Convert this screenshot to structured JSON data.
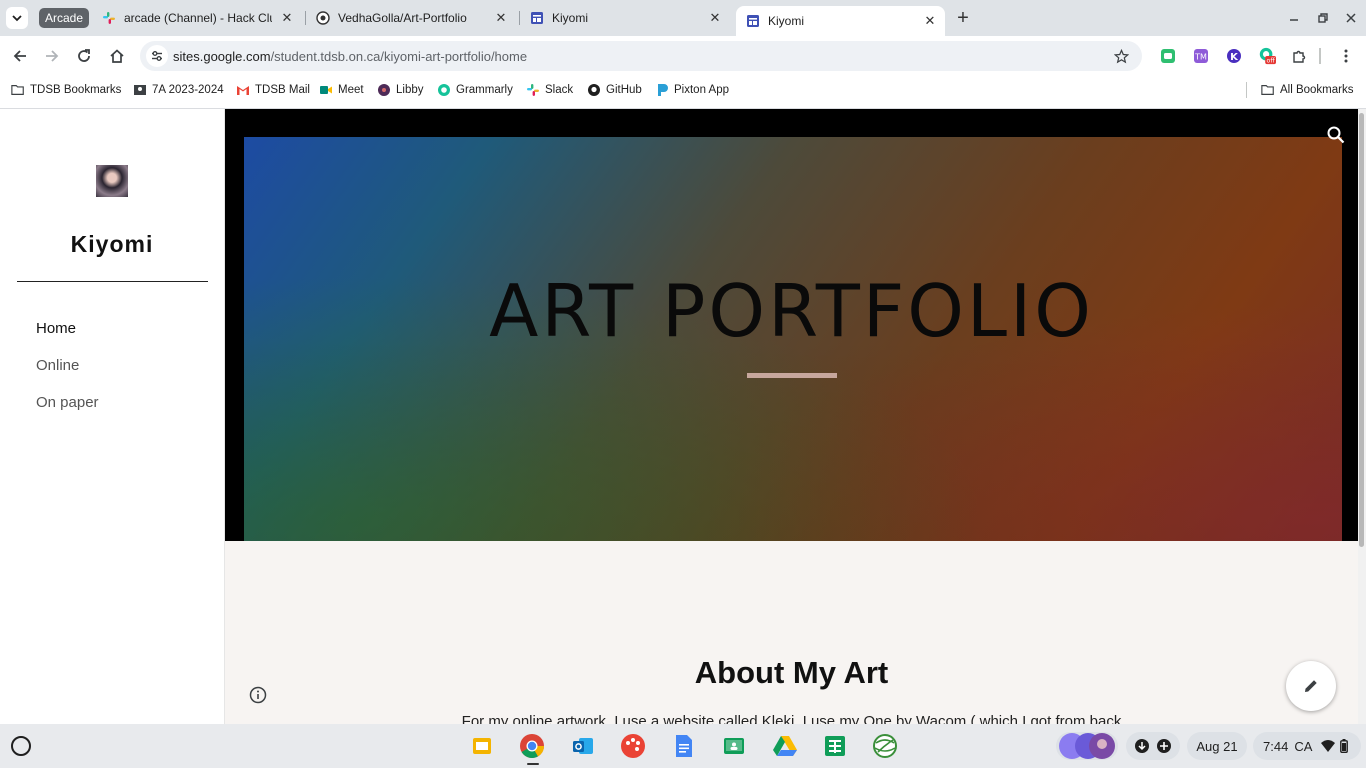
{
  "tabs": {
    "group_label": "Arcade",
    "items": [
      {
        "title": "arcade (Channel) - Hack Club -",
        "icon": "slack-icon"
      },
      {
        "title": "VedhaGolla/Art-Portfolio",
        "icon": "github-icon"
      },
      {
        "title": "Kiyomi",
        "icon": "google-sites-icon"
      },
      {
        "title": "Kiyomi",
        "icon": "google-sites-icon"
      }
    ],
    "close_glyph": "✕",
    "new_tab_glyph": "+"
  },
  "toolbar": {
    "url_host": "sites.google.com",
    "url_path": "/student.tdsb.on.ca/kiyomi-art-portfolio/home"
  },
  "bookmarks": {
    "items": [
      "TDSB Bookmarks",
      "7A 2023-2024",
      "TDSB Mail",
      "Meet",
      "Libby",
      "Grammarly",
      "Slack",
      "GitHub",
      "Pixton App"
    ],
    "all_label": "All Bookmarks"
  },
  "site": {
    "title": "Kiyomi",
    "nav": [
      "Home",
      "Online",
      "On paper"
    ],
    "hero_title": "ART PORTFOLIO",
    "about_title": "About My Art",
    "about_text": "For my online artwork, I use a website called Kleki. I use my One by Wacom ( which I got from back"
  },
  "shelf": {
    "date": "Aug 21",
    "time": "7:44",
    "locale": "CA",
    "ext_badge": "off"
  },
  "colors": {
    "accent": "#1a73e8",
    "hero_left": "#1d4ba3",
    "hero_right": "#7f3a14",
    "hero_bar": "#c7a79d",
    "page_bg": "#f7f4f2"
  }
}
